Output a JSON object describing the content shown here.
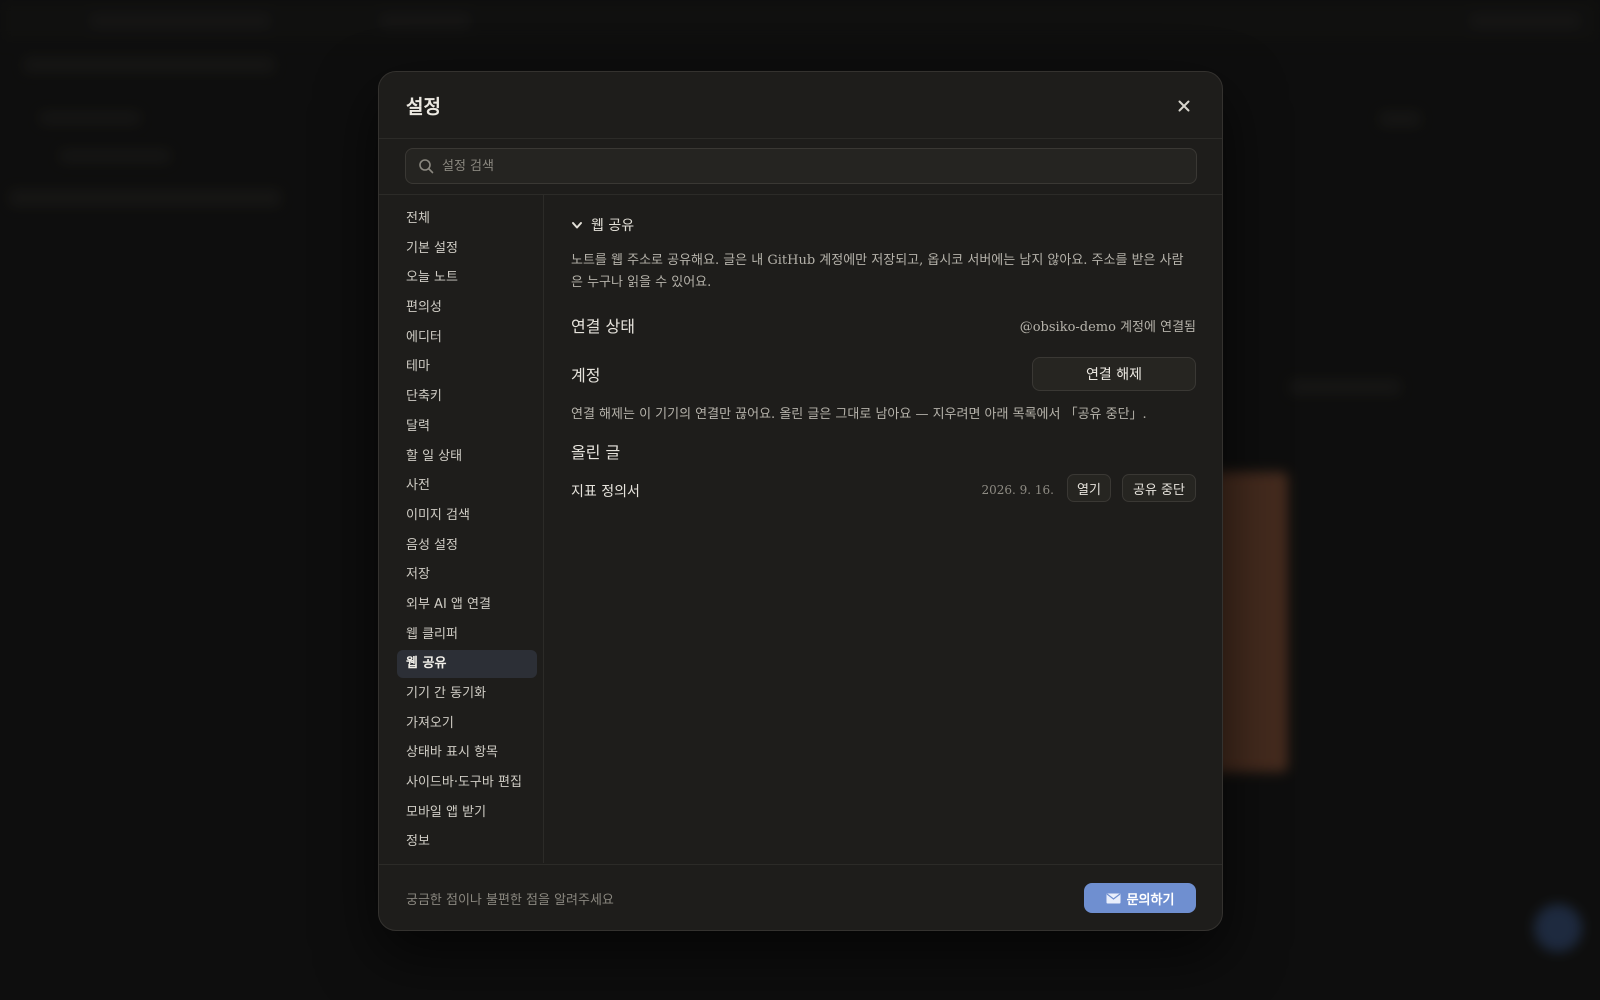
{
  "modal": {
    "title": "설정",
    "search_placeholder": "설정 검색"
  },
  "sidebar": {
    "items": [
      {
        "label": "전체",
        "active": false
      },
      {
        "label": "기본 설정",
        "active": false
      },
      {
        "label": "오늘 노트",
        "active": false
      },
      {
        "label": "편의성",
        "active": false
      },
      {
        "label": "에디터",
        "active": false
      },
      {
        "label": "테마",
        "active": false
      },
      {
        "label": "단축키",
        "active": false
      },
      {
        "label": "달력",
        "active": false
      },
      {
        "label": "할 일 상태",
        "active": false
      },
      {
        "label": "사전",
        "active": false
      },
      {
        "label": "이미지 검색",
        "active": false
      },
      {
        "label": "음성 설정",
        "active": false
      },
      {
        "label": "저장",
        "active": false
      },
      {
        "label": "외부 AI 앱 연결",
        "active": false
      },
      {
        "label": "웹 클리퍼",
        "active": false
      },
      {
        "label": "웹 공유",
        "active": true
      },
      {
        "label": "기기 간 동기화",
        "active": false
      },
      {
        "label": "가져오기",
        "active": false
      },
      {
        "label": "상태바 표시 항목",
        "active": false
      },
      {
        "label": "사이드바·도구바 편집",
        "active": false
      },
      {
        "label": "모바일 앱 받기",
        "active": false
      },
      {
        "label": "정보",
        "active": false
      }
    ]
  },
  "content": {
    "section_title": "웹 공유",
    "description": "노트를 웹 주소로 공유해요. 글은 내 GitHub 계정에만 저장되고, 옵시코 서버에는 남지 않아요. 주소를 받은 사람은 누구나 읽을 수 있어요.",
    "connection": {
      "label": "연결 상태",
      "status": "@obsiko-demo 계정에 연결됨"
    },
    "account": {
      "label": "계정",
      "disconnect_label": "연결 해제",
      "note": "연결 해제는 이 기기의 연결만 끊어요. 올린 글은 그대로 남아요 — 지우려면 아래 목록에서 「공유 중단」."
    },
    "posts": {
      "heading": "올린 글",
      "items": [
        {
          "title": "지표 정의서",
          "date": "2026. 9. 16.",
          "open_label": "열기",
          "stop_label": "공유 중단"
        }
      ]
    }
  },
  "footer": {
    "prompt": "궁금한 점이나 불편한 점을 알려주세요",
    "contact_label": "문의하기"
  },
  "colors": {
    "accent": "#6f8fd0",
    "active_item_bg": "#2c2f36",
    "modal_bg": "#1e1d1b"
  }
}
